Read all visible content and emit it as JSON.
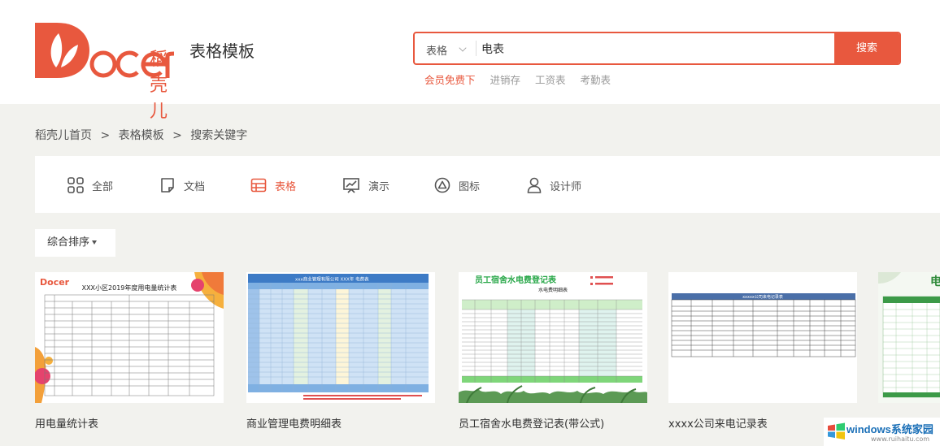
{
  "header": {
    "logo_cn": "稻壳儿",
    "logo_text": "Docer",
    "title": "表格模板"
  },
  "search": {
    "category": "表格",
    "query": "电表",
    "button": "搜索"
  },
  "hot_links": [
    "会员免费下",
    "进销存",
    "工资表",
    "考勤表"
  ],
  "breadcrumb": [
    "稻壳儿首页",
    "表格模板",
    "搜索关键字"
  ],
  "categories": [
    {
      "label": "全部",
      "icon": "grid-icon"
    },
    {
      "label": "文档",
      "icon": "document-icon"
    },
    {
      "label": "表格",
      "icon": "table-icon",
      "active": true
    },
    {
      "label": "演示",
      "icon": "presentation-icon"
    },
    {
      "label": "图标",
      "icon": "shape-icon"
    },
    {
      "label": "设计师",
      "icon": "user-icon"
    }
  ],
  "sort": {
    "label": "综合排序"
  },
  "templates": [
    {
      "title": "用电量统计表",
      "thumb_heading": "XXX小区2019年度用电量统计表",
      "thumb_logo": "Docer"
    },
    {
      "title": "商业管理电费明细表",
      "thumb_heading": "xxx商业管理有限公司 XXX年 电费表"
    },
    {
      "title": "员工宿舍水电费登记表(带公式)",
      "thumb_heading": "员工宿舍水电费登记表",
      "thumb_subheading": "水电费明细表"
    },
    {
      "title": "xxxx公司来电记录表",
      "thumb_heading": "xxxxx公司来电记录表"
    },
    {
      "title": "",
      "thumb_heading": "电"
    }
  ],
  "watermark": {
    "text": "windows系统家园",
    "url": "www.ruihaitu.com"
  },
  "colors": {
    "accent": "#e8583e",
    "background": "#f2f2ee"
  }
}
